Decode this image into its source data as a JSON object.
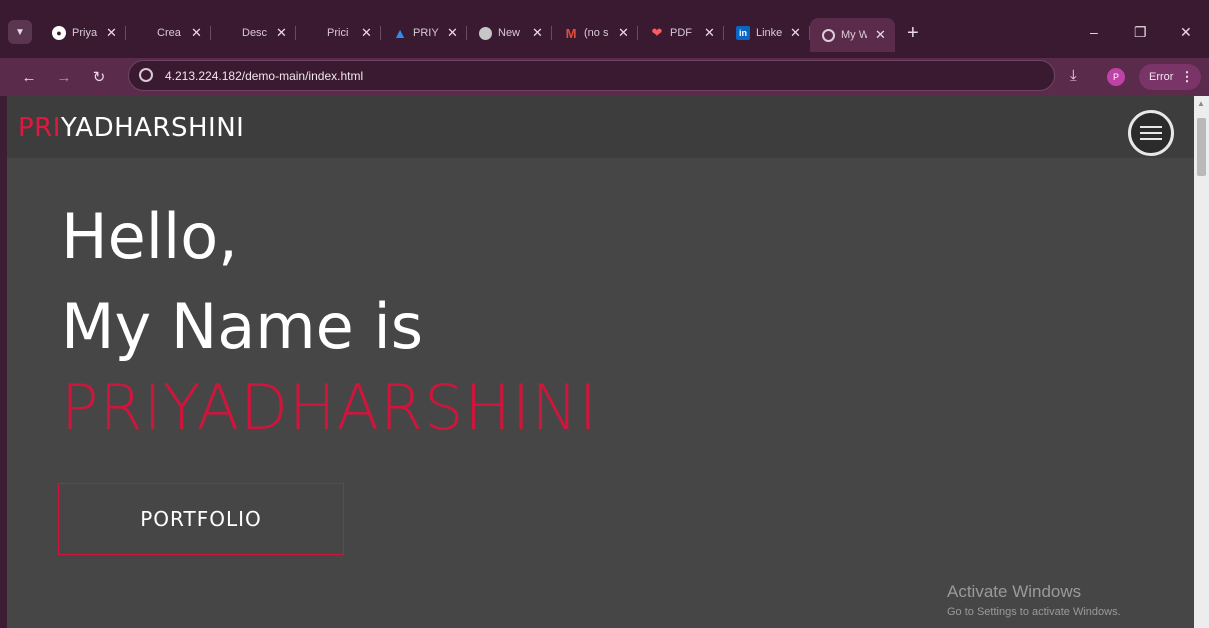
{
  "browser": {
    "tabs": [
      {
        "icon": "github-icon",
        "title": "Priya"
      },
      {
        "icon": "microsoft-icon",
        "title": "Crea"
      },
      {
        "icon": "microsoft-icon",
        "title": "Desc"
      },
      {
        "icon": "microsoft-icon",
        "title": "Prici"
      },
      {
        "icon": "azure-icon",
        "title": "PRIY"
      },
      {
        "icon": "chrome-icon",
        "title": "New"
      },
      {
        "icon": "gmail-icon",
        "title": "(no s"
      },
      {
        "icon": "pdf-heart-icon",
        "title": "PDF"
      },
      {
        "icon": "linkedin-icon",
        "title": "Linke"
      },
      {
        "icon": "globe-icon",
        "title": "My W",
        "active": true
      }
    ],
    "url": "4.213.224.182/demo-main/index.html",
    "profile_initial": "P",
    "error_label": "Error"
  },
  "site": {
    "logo_accent": "PRI",
    "logo_rest": "YADHARSHINI",
    "hero_line1": "Hello,",
    "hero_line2": "My Name is",
    "hero_highlight": "PRIYADHARSHINI",
    "button_label": "PORTFOLIO",
    "accent_color": "#d0153c"
  },
  "watermark": {
    "title": "Activate Windows",
    "subtitle": "Go to Settings to activate Windows."
  }
}
